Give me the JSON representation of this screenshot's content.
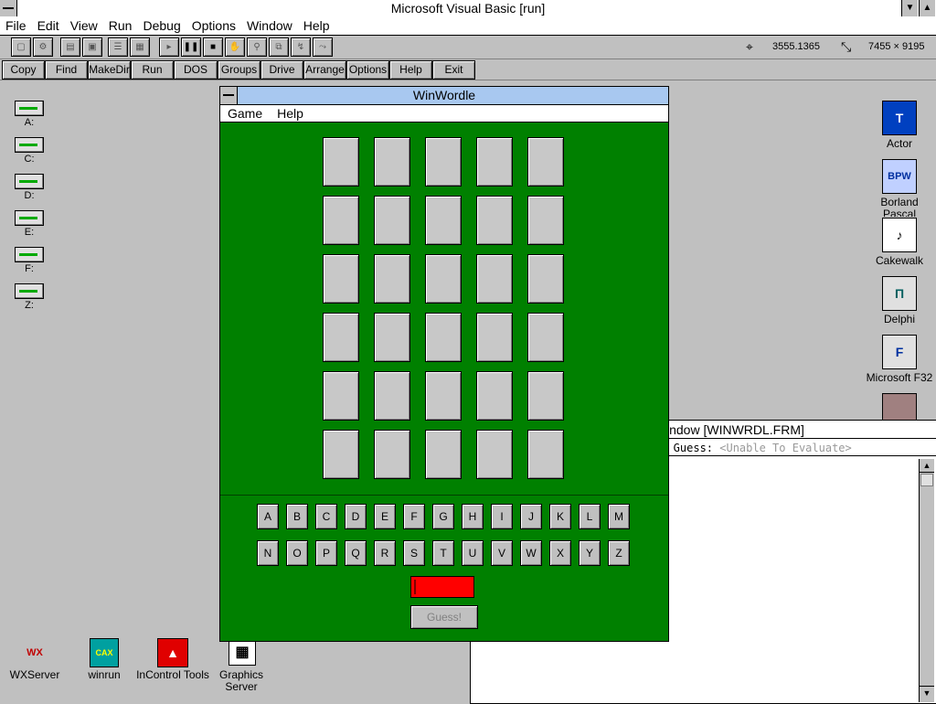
{
  "app": {
    "title": "Microsoft Visual Basic [run]",
    "menu": [
      "File",
      "Edit",
      "View",
      "Run",
      "Debug",
      "Options",
      "Window",
      "Help"
    ],
    "position_readout": "3555.1365",
    "size_readout": "7455 × 9195"
  },
  "command_bar": [
    "Copy",
    "Find",
    "MakeDir",
    "Run",
    "DOS",
    "Groups",
    "Drive",
    "Arrange",
    "Options",
    "Help",
    "Exit"
  ],
  "drives": [
    "A:",
    "C:",
    "D:",
    "E:",
    "F:",
    "Z:"
  ],
  "right_icons": [
    {
      "label": "Actor",
      "glyph": "T"
    },
    {
      "label": "Borland Pascal",
      "glyph": "BPW"
    },
    {
      "label": "Cakewalk",
      "glyph": "♪"
    },
    {
      "label": "Delphi",
      "glyph": "Π"
    },
    {
      "label": "Microsoft F32",
      "glyph": "F"
    }
  ],
  "bottom_icons": [
    {
      "label": "WXServer",
      "glyph": "WX"
    },
    {
      "label": "winrun",
      "glyph": "CAX"
    },
    {
      "label": "InControl Tools",
      "glyph": "▲"
    },
    {
      "label": "Graphics Server",
      "glyph": "▦"
    }
  ],
  "immediate": {
    "title": "indow [WINWRDL.FRM]",
    "watch_prefix": "s] Guess: ",
    "watch_value": "<Unable To Evaluate>"
  },
  "wordle": {
    "title": "WinWordle",
    "menu": [
      "Game",
      "Help"
    ],
    "row1": [
      "A",
      "B",
      "C",
      "D",
      "E",
      "F",
      "G",
      "H",
      "I",
      "J",
      "K",
      "L",
      "M"
    ],
    "row2": [
      "N",
      "O",
      "P",
      "Q",
      "R",
      "S",
      "T",
      "U",
      "V",
      "W",
      "X",
      "Y",
      "Z"
    ],
    "guess_label": "Guess!",
    "guess_value": ""
  },
  "colors": {
    "wordle_background": "#008000",
    "guess_input": "#ff0000",
    "caption_active": "#a8c8f0"
  }
}
